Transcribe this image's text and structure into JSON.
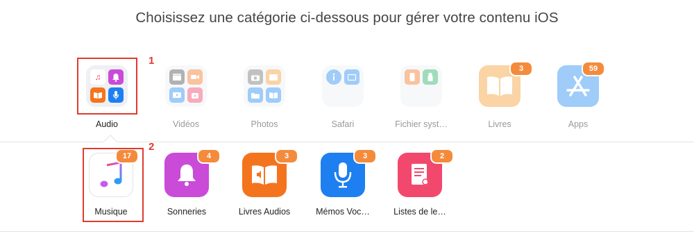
{
  "heading": "Choisissez une catégorie ci-dessous pour gérer votre contenu iOS",
  "categories": [
    {
      "label": "Audio",
      "icon": "audio-folder-icon"
    },
    {
      "label": "Vidéos",
      "icon": "videos-folder-icon"
    },
    {
      "label": "Photos",
      "icon": "photos-folder-icon"
    },
    {
      "label": "Safari",
      "icon": "safari-folder-icon"
    },
    {
      "label": "Fichier syst…",
      "icon": "system-files-folder-icon"
    },
    {
      "label": "Livres",
      "icon": "books-icon",
      "badge": "3"
    },
    {
      "label": "Apps",
      "icon": "app-store-icon",
      "badge": "59"
    }
  ],
  "subcategories": [
    {
      "label": "Musique",
      "icon": "music-icon",
      "badge": "17"
    },
    {
      "label": "Sonneries",
      "icon": "ringtones-bell-icon",
      "badge": "4"
    },
    {
      "label": "Livres Audios",
      "icon": "audiobooks-icon",
      "badge": "3"
    },
    {
      "label": "Mémos Voc…",
      "icon": "voice-memos-icon",
      "badge": "3"
    },
    {
      "label": "Listes de le…",
      "icon": "playlists-icon",
      "badge": "2"
    }
  ],
  "annotations": [
    {
      "number": "1"
    },
    {
      "number": "2"
    }
  ],
  "colors": {
    "highlight": "#e03a2f",
    "badge": "#f48b3c",
    "ringtones": "#c94bd8",
    "audiobooks": "#f4741d",
    "voice_memos": "#1e7ff0",
    "playlists": "#f2486e",
    "books": "#f6a13a",
    "apps": "#2d8ff3"
  }
}
